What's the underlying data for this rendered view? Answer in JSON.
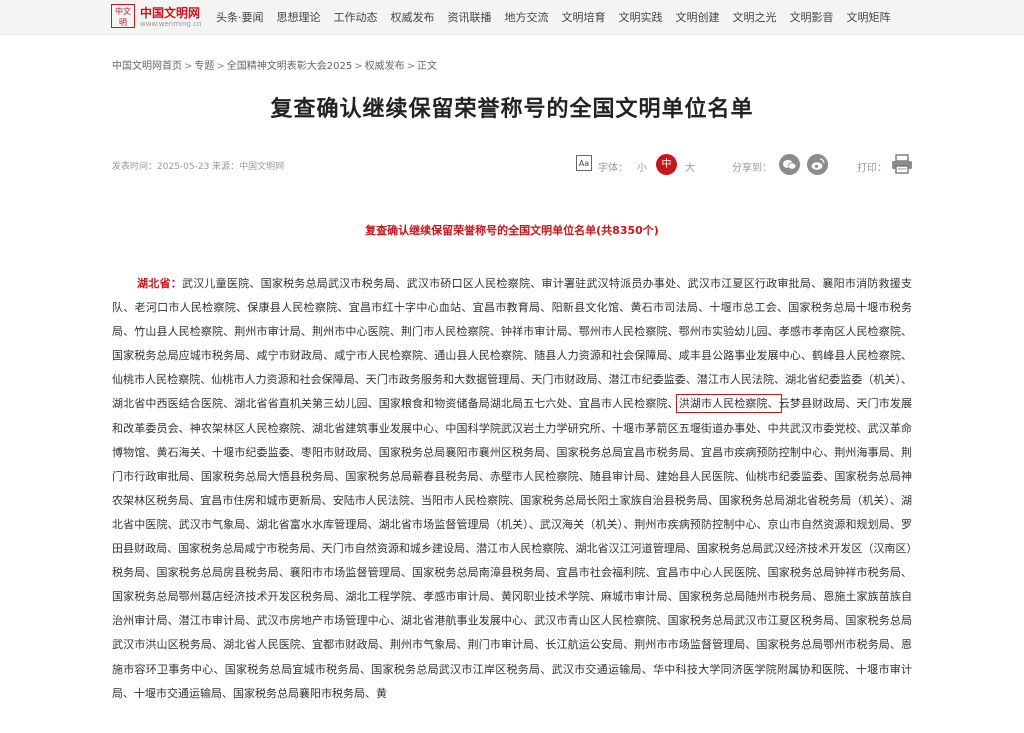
{
  "site": {
    "logo_mark": "中文明",
    "logo_name": "中国文明网",
    "logo_url": "www.wenming.cn"
  },
  "nav": [
    "头条·要闻",
    "思想理论",
    "工作动态",
    "权威发布",
    "资讯联播",
    "地方交流",
    "文明培育",
    "文明实践",
    "文明创建",
    "文明之光",
    "文明影音",
    "文明矩阵"
  ],
  "breadcrumb": [
    "中国文明网首页",
    "专题",
    "全国精神文明表彰大会2025",
    "权威发布",
    "正文"
  ],
  "breadcrumb_sep": ">",
  "article": {
    "title": "复查确认继续保留荣誉称号的全国文明单位名单",
    "meta": "发表时间：2025-05-23 来源：中国文明网",
    "subtitle": "复查确认继续保留荣誉称号的全国文明单位名单(共8350个)",
    "province": "湖北省：",
    "text_before": "武汉儿童医院、国家税务总局武汉市税务局、武汉市硚口区人民检察院、审计署驻武汉特派员办事处、武汉市江夏区行政审批局、襄阳市消防救援支队、老河口市人民检察院、保康县人民检察院、宜昌市红十字中心血站、宜昌市教育局、阳新县文化馆、黄石市司法局、十堰市总工会、国家税务总局十堰市税务局、竹山县人民检察院、荆州市审计局、荆州市中心医院、荆门市人民检察院、钟祥市审计局、鄂州市人民检察院、鄂州市实验幼儿园、孝感市孝南区人民检察院、国家税务总局应城市税务局、咸宁市财政局、咸宁市人民检察院、通山县人民检察院、随县人力资源和社会保障局、咸丰县公路事业发展中心、鹤峰县人民检察院、仙桃市人民检察院、仙桃市人力资源和社会保障局、天门市政务服务和大数据管理局、天门市财政局、潜江市纪委监委、潜江市人民法院、湖北省纪委监委（机关）、湖北省中西医结合医院、湖北省省直机关第三幼儿园、国家粮食和物资储备局湖北局五七六处、宜昌市人民检察院、",
    "highlighted": "洪湖市人民检察院、",
    "text_after": "云梦县财政局、天门市发展和改革委员会、神农架林区人民检察院、湖北省建筑事业发展中心、中国科学院武汉岩土力学研究所、十堰市茅箭区五堰街道办事处、中共武汉市委党校、武汉革命博物馆、黄石海关、十堰市纪委监委、枣阳市财政局、国家税务总局襄阳市襄州区税务局、国家税务总局宜昌市税务局、宜昌市疾病预防控制中心、荆州海事局、荆门市行政审批局、国家税务总局大悟县税务局、国家税务总局蕲春县税务局、赤壁市人民检察院、随县审计局、建始县人民医院、仙桃市纪委监委、国家税务总局神农架林区税务局、宜昌市住房和城市更新局、安陆市人民法院、当阳市人民检察院、国家税务总局长阳土家族自治县税务局、国家税务总局湖北省税务局（机关）、湖北省中医院、武汉市气象局、湖北省富水水库管理局、湖北省市场监督管理局（机关）、武汉海关（机关）、荆州市疾病预防控制中心、京山市自然资源和规划局、罗田县财政局、国家税务总局咸宁市税务局、天门市自然资源和城乡建设局、潜江市人民检察院、湖北省汉江河道管理局、国家税务总局武汉经济技术开发区（汉南区）税务局、国家税务总局房县税务局、襄阳市市场监督管理局、国家税务总局南漳县税务局、宜昌市社会福利院、宜昌市中心人民医院、国家税务总局钟祥市税务局、国家税务总局鄂州葛店经济技术开发区税务局、湖北工程学院、孝感市审计局、黄冈职业技术学院、麻城市审计局、国家税务总局随州市税务局、恩施土家族苗族自治州审计局、潜江市审计局、武汉市房地产市场管理中心、湖北省港航事业发展中心、武汉市青山区人民检察院、国家税务总局武汉市江夏区税务局、国家税务总局武汉市洪山区税务局、湖北省人民医院、宜都市财政局、荆州市气象局、荆门市审计局、长江航运公安局、荆州市市场监督管理局、国家税务总局鄂州市税务局、恩施市容环卫事务中心、国家税务总局宜城市税务局、国家税务总局武汉市江岸区税务局、武汉市交通运输局、华中科技大学同济医学院附属协和医院、十堰市审计局、十堰市交通运输局、国家税务总局襄阳市税务局、黄"
  },
  "tools": {
    "font_size_label": "字体：",
    "font_small": "小",
    "font_medium": "中",
    "font_large": "大",
    "share_label": "分享到：",
    "print_label": "打印："
  }
}
